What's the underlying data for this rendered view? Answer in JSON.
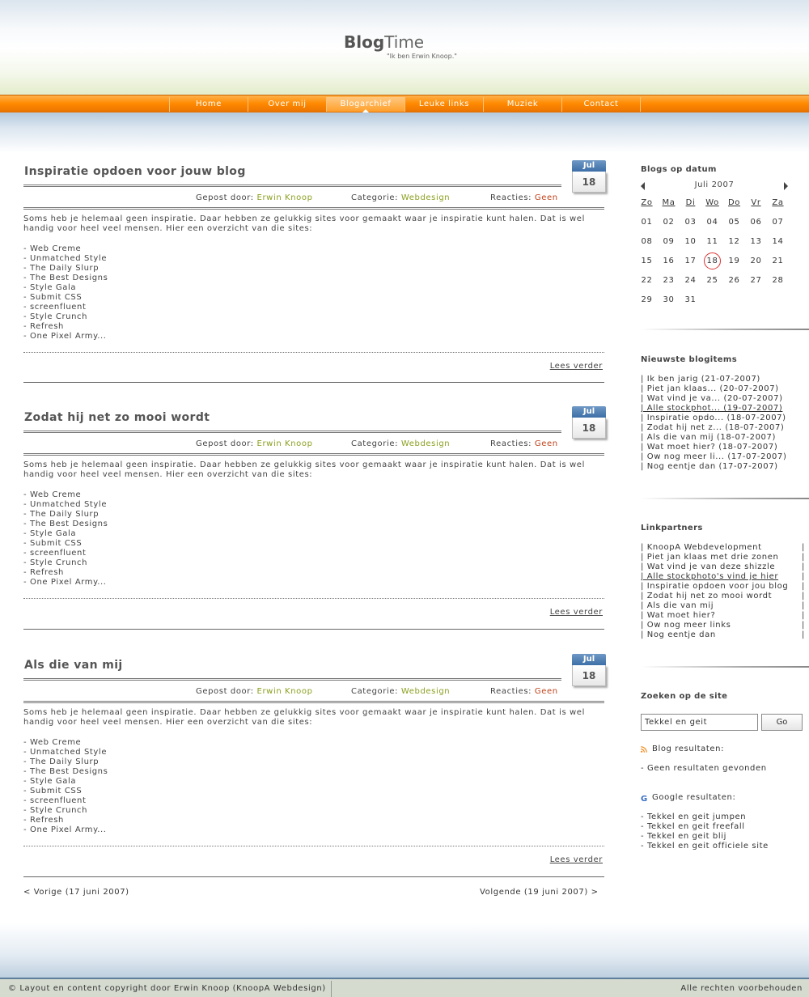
{
  "header": {
    "logo_bold": "Blog",
    "logo_thin": "Time",
    "tagline": "\"Ik ben Erwin Knoop.\""
  },
  "nav": {
    "items": [
      "Home",
      "Over mij",
      "Blogarchief",
      "Leuke links",
      "Muziek",
      "Contact"
    ],
    "active": "Blogarchief"
  },
  "posts": [
    {
      "title": "Inspiratie opdoen voor jouw blog",
      "cal_month": "Jul",
      "cal_day": "18",
      "posted_by_label": "Gepost door:",
      "author": "Erwin Knoop",
      "category_label": "Categorie:",
      "category": "Webdesign",
      "comments_label": "Reacties:",
      "comments": "Geen",
      "text": "Soms heb je helemaal geen inspiratie. Daar hebben ze gelukkig sites voor gemaakt waar je inspiratie kunt halen. Dat is wel handig voor heel veel mensen. Hier een overzicht van die sites:",
      "list": [
        "- Web Creme",
        "- Unmatched Style",
        "- The Daily Slurp",
        "- The Best Designs",
        "- Style Gala",
        "- Submit CSS",
        "- screenfluent",
        "- Style Crunch",
        "- Refresh",
        "- One Pixel Army..."
      ],
      "read_more": "Lees verder"
    },
    {
      "title": "Zodat hij net zo mooi wordt",
      "cal_month": "Jul",
      "cal_day": "18",
      "posted_by_label": "Gepost door:",
      "author": "Erwin Knoop",
      "category_label": "Categorie:",
      "category": "Webdesign",
      "comments_label": "Reacties:",
      "comments": "Geen",
      "text": "Soms heb je helemaal geen inspiratie. Daar hebben ze gelukkig sites voor gemaakt waar je inspiratie kunt halen. Dat is wel handig voor heel veel mensen. Hier een overzicht van die sites:",
      "list": [
        "- Web Creme",
        "- Unmatched Style",
        "- The Daily Slurp",
        "- The Best Designs",
        "- Style Gala",
        "- Submit CSS",
        "- screenfluent",
        "- Style Crunch",
        "- Refresh",
        "- One Pixel Army..."
      ],
      "read_more": "Lees verder"
    },
    {
      "title": "Als die van mij",
      "cal_month": "Jul",
      "cal_day": "18",
      "posted_by_label": "Gepost door:",
      "author": "Erwin Knoop",
      "category_label": "Categorie:",
      "category": "Webdesign",
      "comments_label": "Reacties:",
      "comments": "Geen",
      "text": "Soms heb je helemaal geen inspiratie. Daar hebben ze gelukkig sites voor gemaakt waar je inspiratie kunt halen. Dat is wel handig voor heel veel mensen. Hier een overzicht van die sites:",
      "list": [
        "- Web Creme",
        "- Unmatched Style",
        "- The Daily Slurp",
        "- The Best Designs",
        "- Style Gala",
        "- Submit CSS",
        "- screenfluent",
        "- Style Crunch",
        "- Refresh",
        "- One Pixel Army..."
      ],
      "read_more": "Lees verder"
    }
  ],
  "pager": {
    "prev": "< Vorige (17 juni 2007)",
    "next": "Volgende (19 juni 2007) >"
  },
  "sidebar": {
    "calendar": {
      "heading": "Blogs op datum",
      "month": "Juli 2007",
      "weekdays": [
        "Zo",
        "Ma",
        "Di",
        "Wo",
        "Do",
        "Vr",
        "Za"
      ],
      "weeks": [
        [
          "01",
          "02",
          "03",
          "04",
          "05",
          "06",
          "07"
        ],
        [
          "08",
          "09",
          "10",
          "11",
          "12",
          "13",
          "14"
        ],
        [
          "15",
          "16",
          "17",
          "18",
          "19",
          "20",
          "21"
        ],
        [
          "22",
          "23",
          "24",
          "25",
          "26",
          "27",
          "28"
        ],
        [
          "29",
          "30",
          "31",
          "",
          "",
          "",
          ""
        ]
      ],
      "today": "18"
    },
    "newest": {
      "heading": "Nieuwste blogitems",
      "items": [
        "| Ik ben jarig (21-07-2007)",
        "| Piet jan klaas... (20-07-2007)",
        "| Wat vind je va... (20-07-2007)",
        "| Alle stockphot... (19-07-2007)",
        "| Inspiratie opdo... (18-07-2007)",
        "| Zodat hij net z... (18-07-2007)",
        "| Als die van mij (18-07-2007)",
        "| Wat moet hier? (18-07-2007)",
        "| Ow nog meer li... (17-07-2007)",
        "| Nog eentje dan (17-07-2007)"
      ],
      "underlined_index": 3
    },
    "links": {
      "heading": "Linkpartners",
      "items": [
        "| KnoopA Webdevelopment",
        "| Piet jan klaas met drie zonen",
        "| Wat vind je van deze shizzle",
        "| Alle stockphoto's vind je hier",
        "| Inspiratie opdoen voor jou blog",
        "| Zodat hij net zo mooi wordt",
        "| Als die van mij",
        "| Wat moet hier?",
        "| Ow nog meer links",
        "| Nog eentje dan"
      ],
      "pipe": "|",
      "underlined_index": 3
    },
    "search": {
      "heading": "Zoeken op de site",
      "value": "Tekkel en geit",
      "button": "Go",
      "blog_results_label": "Blog resultaten:",
      "blog_results": [
        "- Geen resultaten gevonden"
      ],
      "google_icon": "G",
      "google_results_label": "Google resultaten:",
      "google_results": [
        "- Tekkel en geit jumpen",
        "- Tekkel en geit freefall",
        "- Tekkel en geit blij",
        "- Tekkel en geit officiele site"
      ]
    }
  },
  "footer": {
    "left": "© Layout en content copyright door Erwin Knoop (KnoopA Webdesign)",
    "right": "Alle rechten voorbehouden"
  },
  "colors": {
    "accent_orange": "#ff8a00",
    "link_green": "#8aa01e",
    "comments_red": "#c0421a",
    "calendar_blue": "#3d6ea6"
  }
}
